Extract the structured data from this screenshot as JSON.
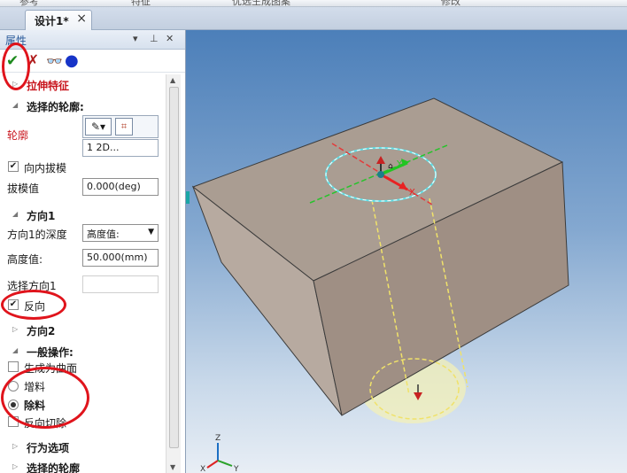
{
  "ribbon": {
    "items": [
      "参考",
      "特征",
      "优选生成图案",
      "修改"
    ]
  },
  "document": {
    "tab_title": "设计1*",
    "close": "×"
  },
  "panel": {
    "title": "属性",
    "controls": {
      "pin": "▾",
      "dock": "⊥",
      "close": "✕"
    },
    "toolbar": {
      "ok": "✔",
      "cancel": "✗",
      "preview": "👓",
      "apply": "●"
    },
    "feature_title": "拉伸特征",
    "selected_profile_section": "选择的轮廓:",
    "profile_label": "轮廓",
    "profile_item": "1    2D...",
    "inward_draft_label": "向内拔模",
    "inward_draft_checked": true,
    "draft_value_label": "拔模值",
    "draft_value": "0.000(deg)",
    "direction1_section": "方向1",
    "depth1_label": "方向1的深度",
    "depth1_value": "高度值:",
    "height_label": "高度值:",
    "height_value": "50.000(mm)",
    "select_dir1_label": "选择方向1",
    "reverse_label": "反向",
    "reverse_checked": true,
    "direction2_section": "方向2",
    "general_ops_section": "一般操作:",
    "gen_surface_label": "生成为曲面",
    "add_material_label": "增料",
    "remove_material_label": "除料",
    "remove_material_selected": true,
    "reverse_cut_label": "反向切除",
    "behavior_section": "行为选项",
    "selected_profile2_section": "选择的轮廓"
  },
  "viewport": {
    "triad": {
      "z": "Z",
      "x": "X",
      "y": "Y"
    },
    "axis_labels": {
      "x": "X",
      "y": "Y"
    }
  },
  "colors": {
    "annotation": "#e0141c",
    "box_top": "#aa9d92",
    "box_front": "#9f8f84",
    "box_side": "#b7aaa0",
    "profile": "#5ee0e8"
  }
}
